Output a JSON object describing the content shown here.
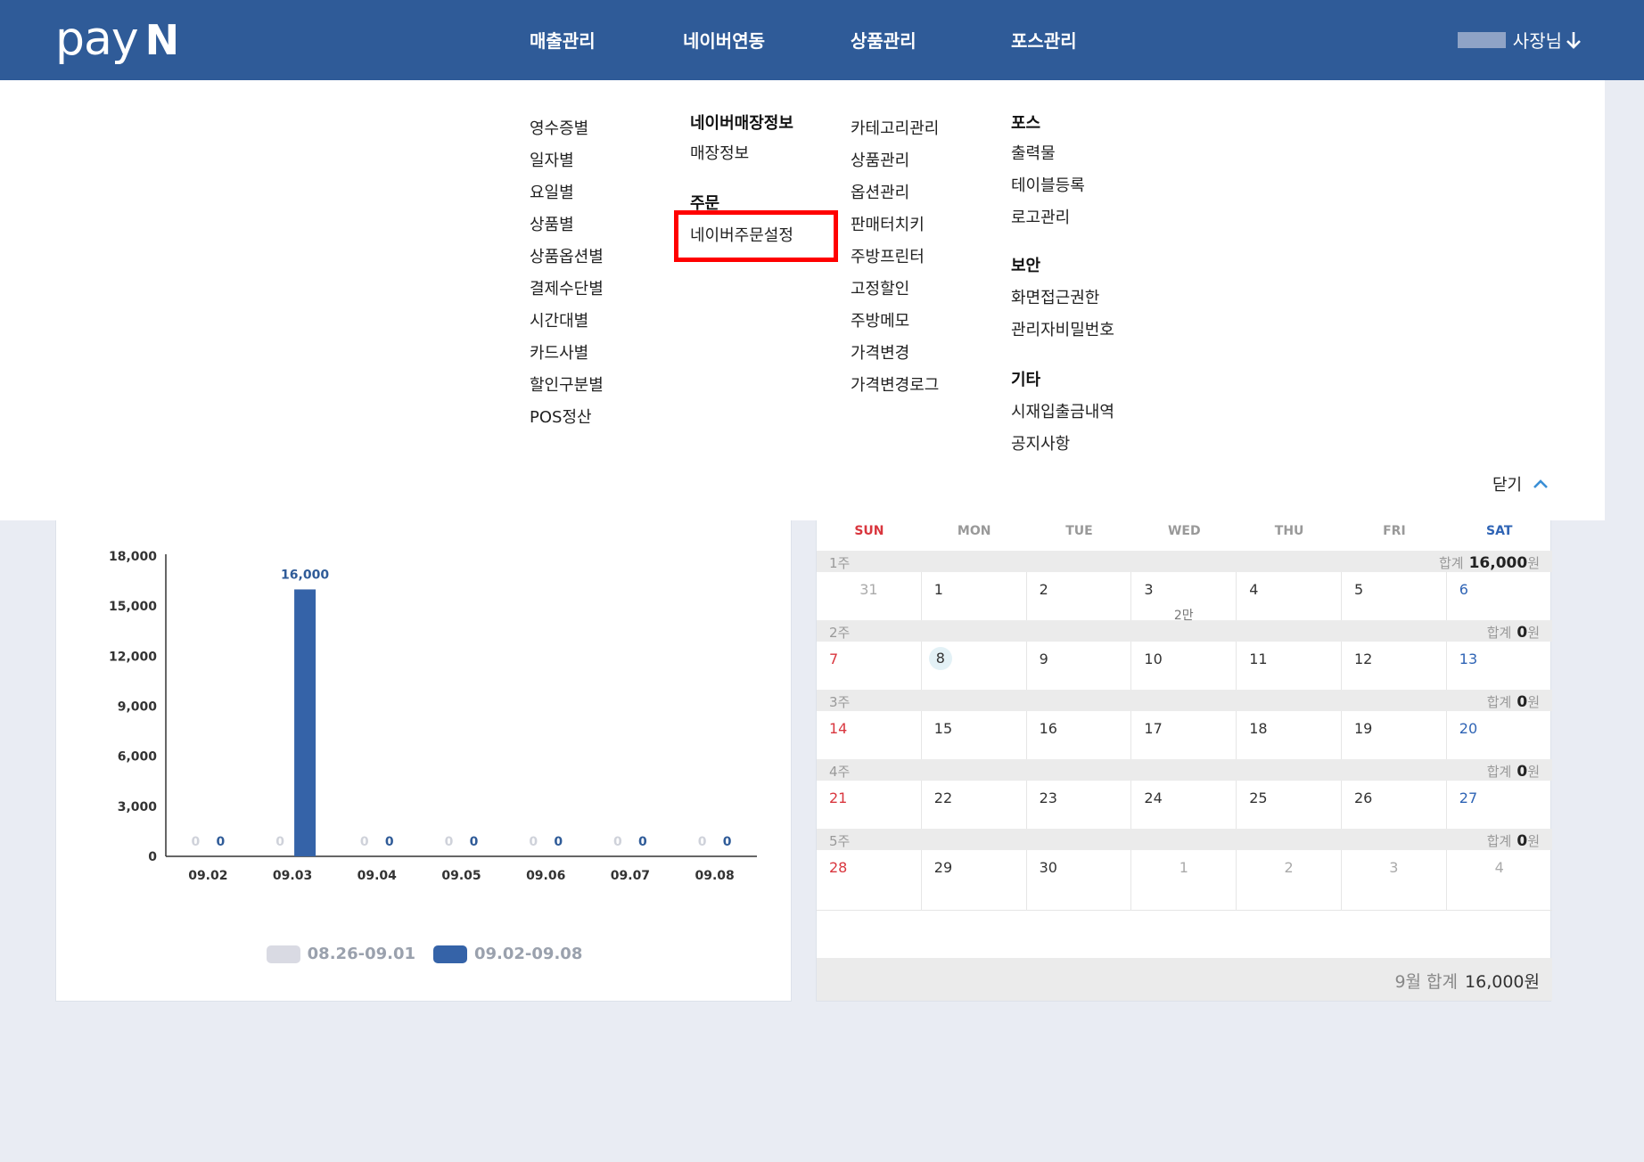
{
  "header": {
    "logo_text": "pay",
    "logo_mark": "N",
    "nav": [
      {
        "label": "매출관리"
      },
      {
        "label": "네이버연동"
      },
      {
        "label": "상품관리"
      },
      {
        "label": "포스관리"
      }
    ],
    "user_label": "사장님",
    "user_arrow_icon": "arrow-down-icon"
  },
  "megamenu": {
    "sales": [
      "영수증별",
      "일자별",
      "요일별",
      "상품별",
      "상품옵션별",
      "결제수단별",
      "시간대별",
      "카드사별",
      "할인구분별",
      "POS정산"
    ],
    "naver": {
      "store_head": "네이버매장정보",
      "store_items": [
        "매장정보"
      ],
      "order_head": "주문",
      "order_items": [
        "네이버주문설정"
      ]
    },
    "products": [
      "카테고리관리",
      "상품관리",
      "옵션관리",
      "판매터치키",
      "주방프린터",
      "고정할인",
      "주방메모",
      "가격변경",
      "가격변경로그"
    ],
    "pos": {
      "pos_head": "포스",
      "pos_items": [
        "출력물",
        "테이블등록",
        "로고관리"
      ],
      "security_head": "보안",
      "security_items": [
        "화면접근권한",
        "관리자비밀번호"
      ],
      "etc_head": "기타",
      "etc_items": [
        "시재입출금내역",
        "공지사항"
      ]
    },
    "close_label": "닫기",
    "close_icon": "chevron-up-icon",
    "highlight_color": "#ff0000"
  },
  "chart_data": {
    "type": "bar",
    "categories": [
      "09.02",
      "09.03",
      "09.04",
      "09.05",
      "09.06",
      "09.07",
      "09.08"
    ],
    "series": [
      {
        "name": "08.26-09.01",
        "color": "#d9dae3",
        "values": [
          0,
          0,
          0,
          0,
          0,
          0,
          0
        ]
      },
      {
        "name": "09.02-09.08",
        "color": "#3563a8",
        "values": [
          0,
          16000,
          0,
          0,
          0,
          0,
          0
        ]
      }
    ],
    "ylim": [
      0,
      18000
    ],
    "yticks": [
      "0",
      "3,000",
      "6,000",
      "9,000",
      "12,000",
      "15,000",
      "18,000"
    ],
    "data_labels": [
      {
        "prev": "0",
        "curr": "0"
      },
      {
        "prev": "0",
        "curr": "16,000"
      },
      {
        "prev": "0",
        "curr": "0"
      },
      {
        "prev": "0",
        "curr": "0"
      },
      {
        "prev": "0",
        "curr": "0"
      },
      {
        "prev": "0",
        "curr": "0"
      },
      {
        "prev": "0",
        "curr": "0"
      }
    ],
    "legend_position": "bottom-center",
    "grid": false
  },
  "calendar": {
    "days_of_week": [
      "SUN",
      "MON",
      "TUE",
      "WED",
      "THU",
      "FRI",
      "SAT"
    ],
    "sum_label": "합계",
    "currency": "원",
    "weeks": [
      {
        "label": "1주",
        "total": "16,000",
        "days": [
          {
            "d": "31",
            "other": true
          },
          {
            "d": "1"
          },
          {
            "d": "2"
          },
          {
            "d": "3",
            "amt": "2만"
          },
          {
            "d": "4"
          },
          {
            "d": "5"
          },
          {
            "d": "6"
          }
        ]
      },
      {
        "label": "2주",
        "total": "0",
        "days": [
          {
            "d": "7"
          },
          {
            "d": "8",
            "today": true
          },
          {
            "d": "9"
          },
          {
            "d": "10"
          },
          {
            "d": "11"
          },
          {
            "d": "12"
          },
          {
            "d": "13"
          }
        ]
      },
      {
        "label": "3주",
        "total": "0",
        "days": [
          {
            "d": "14"
          },
          {
            "d": "15"
          },
          {
            "d": "16"
          },
          {
            "d": "17"
          },
          {
            "d": "18"
          },
          {
            "d": "19"
          },
          {
            "d": "20"
          }
        ]
      },
      {
        "label": "4주",
        "total": "0",
        "days": [
          {
            "d": "21"
          },
          {
            "d": "22"
          },
          {
            "d": "23"
          },
          {
            "d": "24"
          },
          {
            "d": "25"
          },
          {
            "d": "26"
          },
          {
            "d": "27"
          }
        ]
      },
      {
        "label": "5주",
        "total": "0",
        "days": [
          {
            "d": "28"
          },
          {
            "d": "29"
          },
          {
            "d": "30"
          },
          {
            "d": "1",
            "other": true
          },
          {
            "d": "2",
            "other": true
          },
          {
            "d": "3",
            "other": true
          },
          {
            "d": "4",
            "other": true
          }
        ]
      }
    ],
    "month_total_label": "9월 합계",
    "month_total": "16,000원"
  }
}
